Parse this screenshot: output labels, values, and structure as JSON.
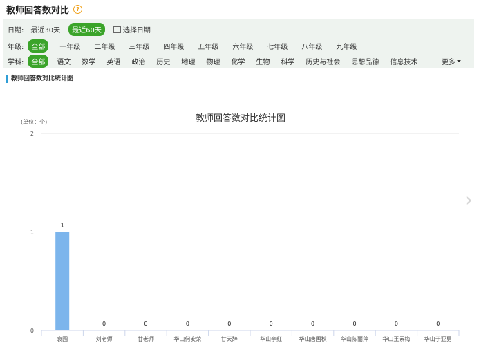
{
  "header": {
    "title": "教师回答数对比",
    "help_icon": "question-circle-icon"
  },
  "filters": {
    "date": {
      "label": "日期:",
      "options": [
        "最近30天",
        "最近60天"
      ],
      "active": "最近60天",
      "pick_label": "选择日期"
    },
    "grade": {
      "label": "年级:",
      "options": [
        "全部",
        "一年级",
        "二年级",
        "三年级",
        "四年级",
        "五年级",
        "六年级",
        "七年级",
        "八年级",
        "九年级"
      ],
      "active": "全部"
    },
    "subject": {
      "label": "学科:",
      "options": [
        "全部",
        "语文",
        "数学",
        "英语",
        "政治",
        "历史",
        "地理",
        "物理",
        "化学",
        "生物",
        "科学",
        "历史与社会",
        "思想品德",
        "信息技术"
      ],
      "active": "全部",
      "more_label": "更多"
    }
  },
  "section": {
    "title": "教师回答数对比统计图"
  },
  "chart_data": {
    "type": "bar",
    "title": "教师回答数对比统计图",
    "unit_label": "(单位：个)",
    "categories": [
      "袁园",
      "刘老师",
      "甘老师",
      "华山何安荣",
      "甘天辞",
      "华山李红",
      "华山唐国秋",
      "华山陈丽萍",
      "华山王素梅",
      "华山于亚男"
    ],
    "values": [
      1,
      0,
      0,
      0,
      0,
      0,
      0,
      0,
      0,
      0
    ],
    "yticks": [
      0,
      1,
      2
    ],
    "ylim": [
      0,
      2
    ],
    "grid": true,
    "bar_color": "#7cb5ec",
    "show_data_labels": true
  },
  "nav": {
    "next_icon": "chevron-right-icon"
  }
}
